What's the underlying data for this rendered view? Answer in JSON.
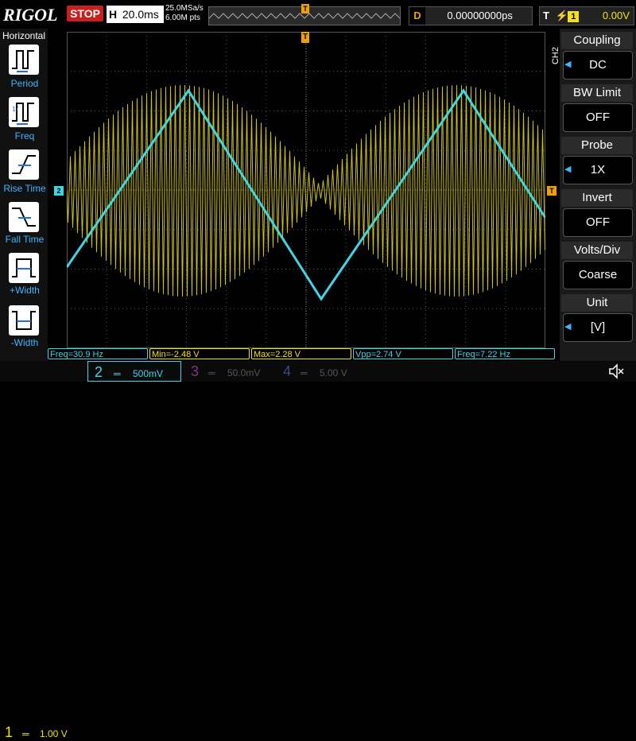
{
  "brand": "RIGOL",
  "run_state": "STOP",
  "horizontal": {
    "label": "H",
    "timebase": "20.0ms",
    "sample_rate": "25.0MSa/s",
    "memory_depth": "6.00M pts"
  },
  "trigger_marker": "T",
  "delay": {
    "label": "D",
    "value": "0.00000000ps"
  },
  "trigger": {
    "label": "T",
    "source": "1",
    "level": "0.00V"
  },
  "left_menu": {
    "title": "Horizontal",
    "items": [
      {
        "label": "Period",
        "icon": "period-icon"
      },
      {
        "label": "Freq",
        "icon": "frequency-icon"
      },
      {
        "label": "Rise Time",
        "icon": "rise-time-icon"
      },
      {
        "label": "Fall Time",
        "icon": "fall-time-icon"
      },
      {
        "label": "+Width",
        "icon": "positive-width-icon"
      },
      {
        "label": "-Width",
        "icon": "negative-width-icon"
      }
    ]
  },
  "right_menu": {
    "channel_tag": "CH2",
    "items": [
      {
        "title": "Coupling",
        "value": "DC",
        "arrow": true
      },
      {
        "title": "BW Limit",
        "value": "OFF",
        "arrow": false
      },
      {
        "title": "Probe",
        "value": "1X",
        "arrow": true
      },
      {
        "title": "Invert",
        "value": "OFF",
        "arrow": false
      },
      {
        "title": "Volts/Div",
        "value": "Coarse",
        "arrow": false
      },
      {
        "title": "Unit",
        "value": "[V]",
        "arrow": true
      }
    ]
  },
  "channel_markers": {
    "ch2": "2"
  },
  "measurements": [
    {
      "text": "Freq=30.9 Hz",
      "channel": 2
    },
    {
      "text": "Min=-2.48 V",
      "channel": 1
    },
    {
      "text": "Max=2.28 V",
      "channel": 1
    },
    {
      "text": "Vpp=2.74 V",
      "channel": 2
    },
    {
      "text": "Freq=7.22 Hz",
      "channel": 2
    }
  ],
  "channels": [
    {
      "number": "1",
      "scale": "1.00 V",
      "color": "#f2e21a",
      "active": true
    },
    {
      "number": "2",
      "scale": "500mV",
      "color": "#3fd6e8",
      "active": true
    },
    {
      "number": "3",
      "scale": "50.0mV",
      "color": "#7a3a7a",
      "active": false
    },
    {
      "number": "4",
      "scale": "5.00 V",
      "color": "#3a4a7a",
      "active": false
    }
  ],
  "colors": {
    "ch1": "#f2e21a",
    "ch2": "#3fd6e8",
    "trigger": "#f0a000",
    "stop": "#c8201e",
    "menu_highlight": "#3fb4ff"
  }
}
